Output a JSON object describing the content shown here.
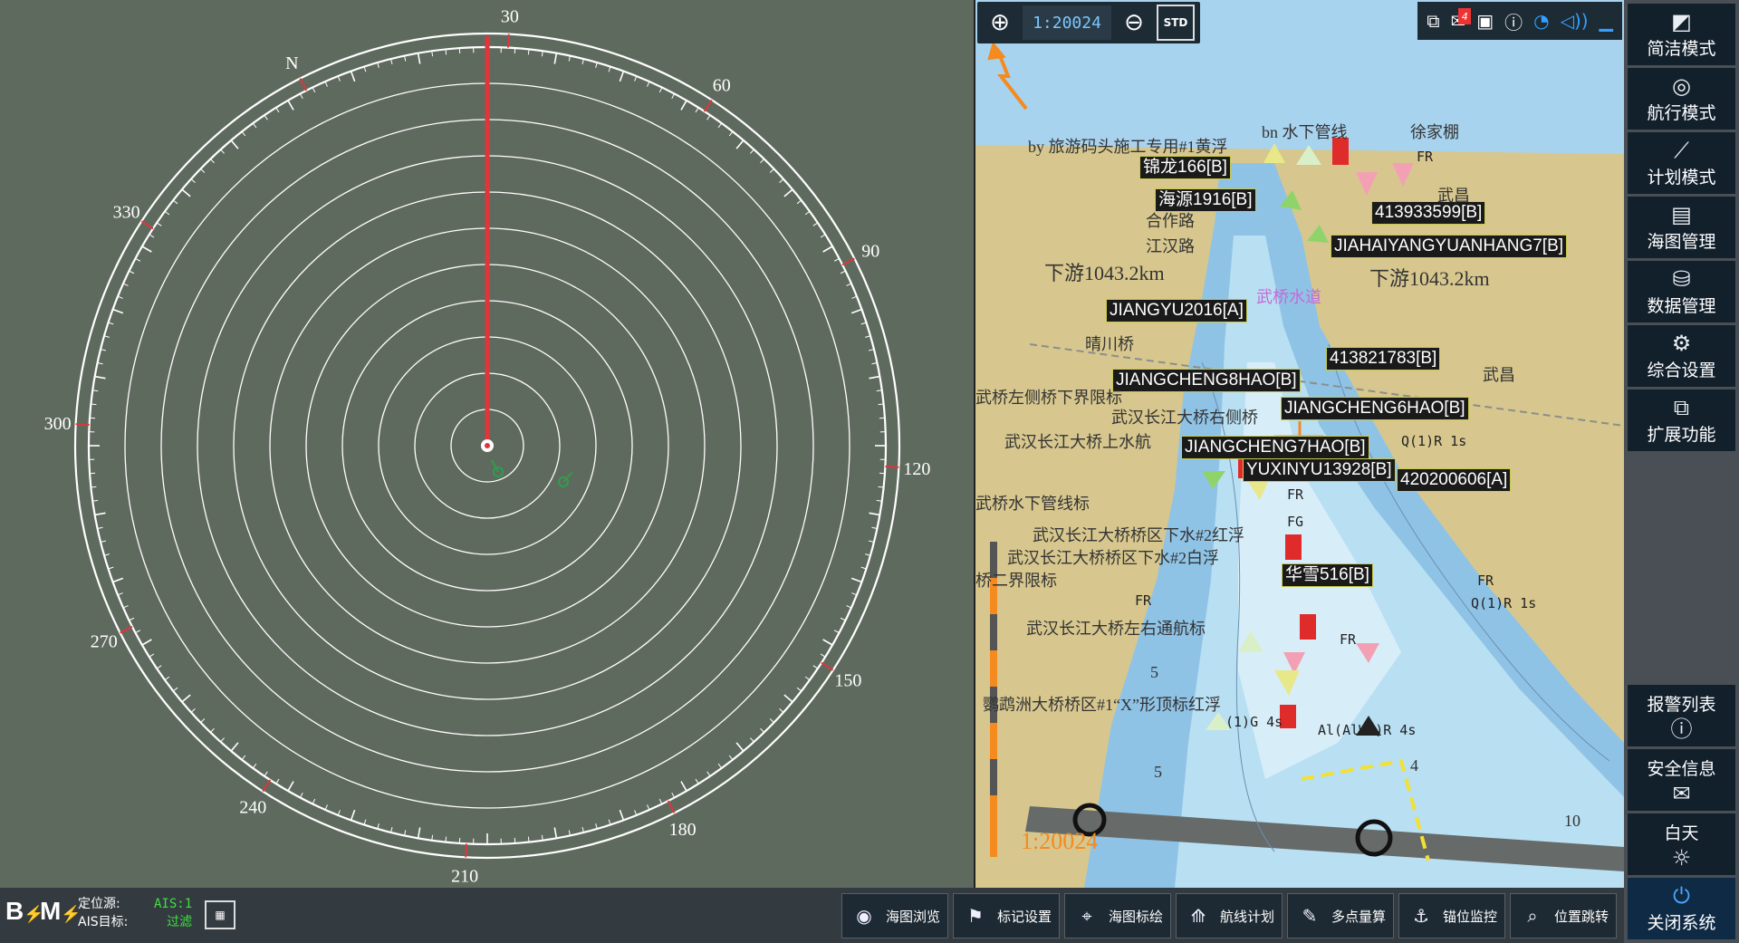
{
  "radar": {
    "bearing_labels": [
      "60",
      "90",
      "30",
      "120",
      "N",
      "150",
      "330",
      "180",
      "300",
      "210",
      "270",
      "240"
    ]
  },
  "chart_toolbar": {
    "zoom_in_icon": "plus-circle-icon",
    "scale": "1:20024",
    "zoom_out_icon": "minus-circle-icon",
    "std_label": "STD"
  },
  "status": {
    "message_count": "4"
  },
  "map": {
    "ship_labels": [
      "锦龙166[B]",
      "海源1916[B]",
      "413933599[B]",
      "JIAHAIYANGYUANHANG7[B]",
      "JIANGYU2016[A]",
      "413821783[B]",
      "JIANGCHENG8HAO[B]",
      "JIANGCHENG6HAO[B]",
      "JIANGCHENG7HAO[B]",
      "YUXINYU13928[B]",
      "420200606[A]",
      "华雪516[B]"
    ],
    "place_labels": [
      "by 旅游码头施工专用#1黄浮",
      "bn 水下管线",
      "徐家棚",
      "FR",
      "武昌",
      "合作路",
      "江汉路",
      "下游1043.2km",
      "下游1043.2km",
      "武桥水道",
      "晴川桥",
      "武昌",
      "武桥左侧桥下界限标",
      "武汉长江大桥右侧桥",
      "武汉长江大桥上水航",
      "Q(1)R 1s",
      "武桥水下管线标",
      "FG",
      "FR",
      "武汉长江大桥桥区下水#2红浮",
      "武汉长江大桥桥区下水#2白浮",
      "桥二界限标",
      "FR",
      "FR",
      "Q(1)R 1s",
      "武汉长江大桥左右通航标",
      "FR",
      "鹦鹉洲大桥桥区#1“X”形顶标红浮",
      "(1)G 4s",
      "Al(AlWR)R 4s",
      "5",
      "5",
      "4",
      "10",
      "1:20024"
    ]
  },
  "sidebar": {
    "top": [
      {
        "label": "简洁模式",
        "icon": "simple-mode-icon"
      },
      {
        "label": "航行模式",
        "icon": "navigation-mode-icon"
      },
      {
        "label": "计划模式",
        "icon": "plan-mode-icon"
      },
      {
        "label": "海图管理",
        "icon": "chart-management-icon"
      },
      {
        "label": "数据管理",
        "icon": "data-management-icon"
      },
      {
        "label": "综合设置",
        "icon": "settings-icon"
      },
      {
        "label": "扩展功能",
        "icon": "extension-icon"
      }
    ],
    "bottom": [
      {
        "label": "报警列表",
        "icon": "alarm-icon"
      },
      {
        "label": "安全信息",
        "icon": "mail-icon"
      },
      {
        "label": "白天",
        "icon": "sun-icon"
      },
      {
        "label": "关闭系统",
        "icon": "power-icon"
      }
    ]
  },
  "bottom_bar": {
    "b_label": "B",
    "m_label": "M",
    "pos_source_label": "定位源:",
    "ais_target_label": "AIS目标:",
    "pos_source_value": "AIS:1",
    "ais_target_value": "过滤",
    "buttons": [
      "海图浏览",
      "标记设置",
      "海图标绘",
      "航线计划",
      "多点量算",
      "锚位监控",
      "位置跳转"
    ]
  }
}
